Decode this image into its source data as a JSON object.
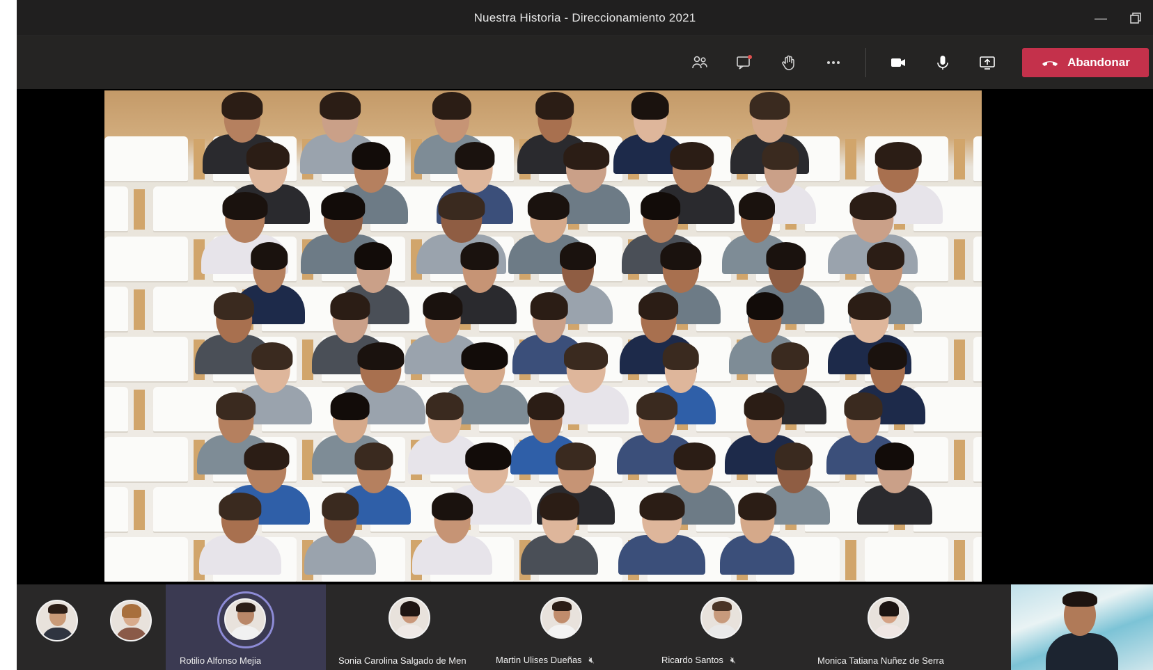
{
  "window": {
    "title": "Nuestra Historia - Direccionamiento 2021",
    "minimize_icon": "minimize-icon",
    "restore_icon": "restore-icon"
  },
  "toolbar": {
    "icons": [
      "participants-icon",
      "chat-icon",
      "raise-hand-icon",
      "more-options-icon",
      "camera-icon",
      "microphone-icon",
      "share-screen-icon"
    ],
    "leave_label": "Abandonar",
    "leave_color": "#c4314b"
  },
  "stage": {
    "mode": "together-mode",
    "seat_color": "#fbfbf9",
    "wall_color": "#c49a68"
  },
  "participants_strip": {
    "tiles": [
      {
        "name": "",
        "active": false,
        "mic_off": false
      },
      {
        "name": "",
        "active": false,
        "mic_off": false
      },
      {
        "name": "Rotilio Alfonso Mejia",
        "active": true,
        "mic_off": false
      },
      {
        "name": "Sonia Carolina Salgado de Men",
        "active": false,
        "mic_off": false
      },
      {
        "name": "Martin Ulises Dueñas",
        "active": false,
        "mic_off": true
      },
      {
        "name": "Ricardo Santos",
        "active": false,
        "mic_off": true
      },
      {
        "name": "Monica Tatiana Nuñez de Serra",
        "active": false,
        "mic_off": false
      }
    ],
    "active_color": "#3b3a52",
    "ring_color": "#8d8bd6"
  }
}
